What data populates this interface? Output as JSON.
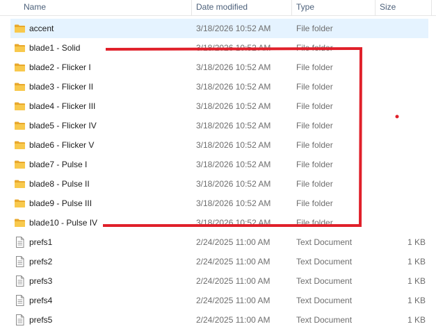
{
  "columns": {
    "name": "Name",
    "date": "Date modified",
    "type": "Type",
    "size": "Size"
  },
  "files": [
    {
      "name": "accent",
      "date": "3/18/2026 10:52 AM",
      "type": "File folder",
      "size": "",
      "icon": "folder-icon",
      "selected": true
    },
    {
      "name": "blade1 - Solid",
      "date": "3/18/2026 10:52 AM",
      "type": "File folder",
      "size": "",
      "icon": "folder-icon"
    },
    {
      "name": "blade2 - Flicker I",
      "date": "3/18/2026 10:52 AM",
      "type": "File folder",
      "size": "",
      "icon": "folder-icon"
    },
    {
      "name": "blade3 - Flicker II",
      "date": "3/18/2026 10:52 AM",
      "type": "File folder",
      "size": "",
      "icon": "folder-icon"
    },
    {
      "name": "blade4 - Flicker III",
      "date": "3/18/2026 10:52 AM",
      "type": "File folder",
      "size": "",
      "icon": "folder-icon"
    },
    {
      "name": "blade5 - Flicker IV",
      "date": "3/18/2026 10:52 AM",
      "type": "File folder",
      "size": "",
      "icon": "folder-icon"
    },
    {
      "name": "blade6 - Flicker V",
      "date": "3/18/2026 10:52 AM",
      "type": "File folder",
      "size": "",
      "icon": "folder-icon"
    },
    {
      "name": "blade7 - Pulse I",
      "date": "3/18/2026 10:52 AM",
      "type": "File folder",
      "size": "",
      "icon": "folder-icon"
    },
    {
      "name": "blade8 - Pulse II",
      "date": "3/18/2026 10:52 AM",
      "type": "File folder",
      "size": "",
      "icon": "folder-icon"
    },
    {
      "name": "blade9 - Pulse III",
      "date": "3/18/2026 10:52 AM",
      "type": "File folder",
      "size": "",
      "icon": "folder-icon"
    },
    {
      "name": "blade10 - Pulse IV",
      "date": "3/18/2026 10:52 AM",
      "type": "File folder",
      "size": "",
      "icon": "folder-icon"
    },
    {
      "name": "prefs1",
      "date": "2/24/2025 11:00 AM",
      "type": "Text Document",
      "size": "1 KB",
      "icon": "text-document-icon"
    },
    {
      "name": "prefs2",
      "date": "2/24/2025 11:00 AM",
      "type": "Text Document",
      "size": "1 KB",
      "icon": "text-document-icon"
    },
    {
      "name": "prefs3",
      "date": "2/24/2025 11:00 AM",
      "type": "Text Document",
      "size": "1 KB",
      "icon": "text-document-icon"
    },
    {
      "name": "prefs4",
      "date": "2/24/2025 11:00 AM",
      "type": "Text Document",
      "size": "1 KB",
      "icon": "text-document-icon"
    },
    {
      "name": "prefs5",
      "date": "2/24/2025 11:00 AM",
      "type": "Text Document",
      "size": "1 KB",
      "icon": "text-document-icon"
    }
  ],
  "colors": {
    "selection": "#e5f3ff",
    "annotation": "#e0202a",
    "folder": "#f5c24a"
  }
}
